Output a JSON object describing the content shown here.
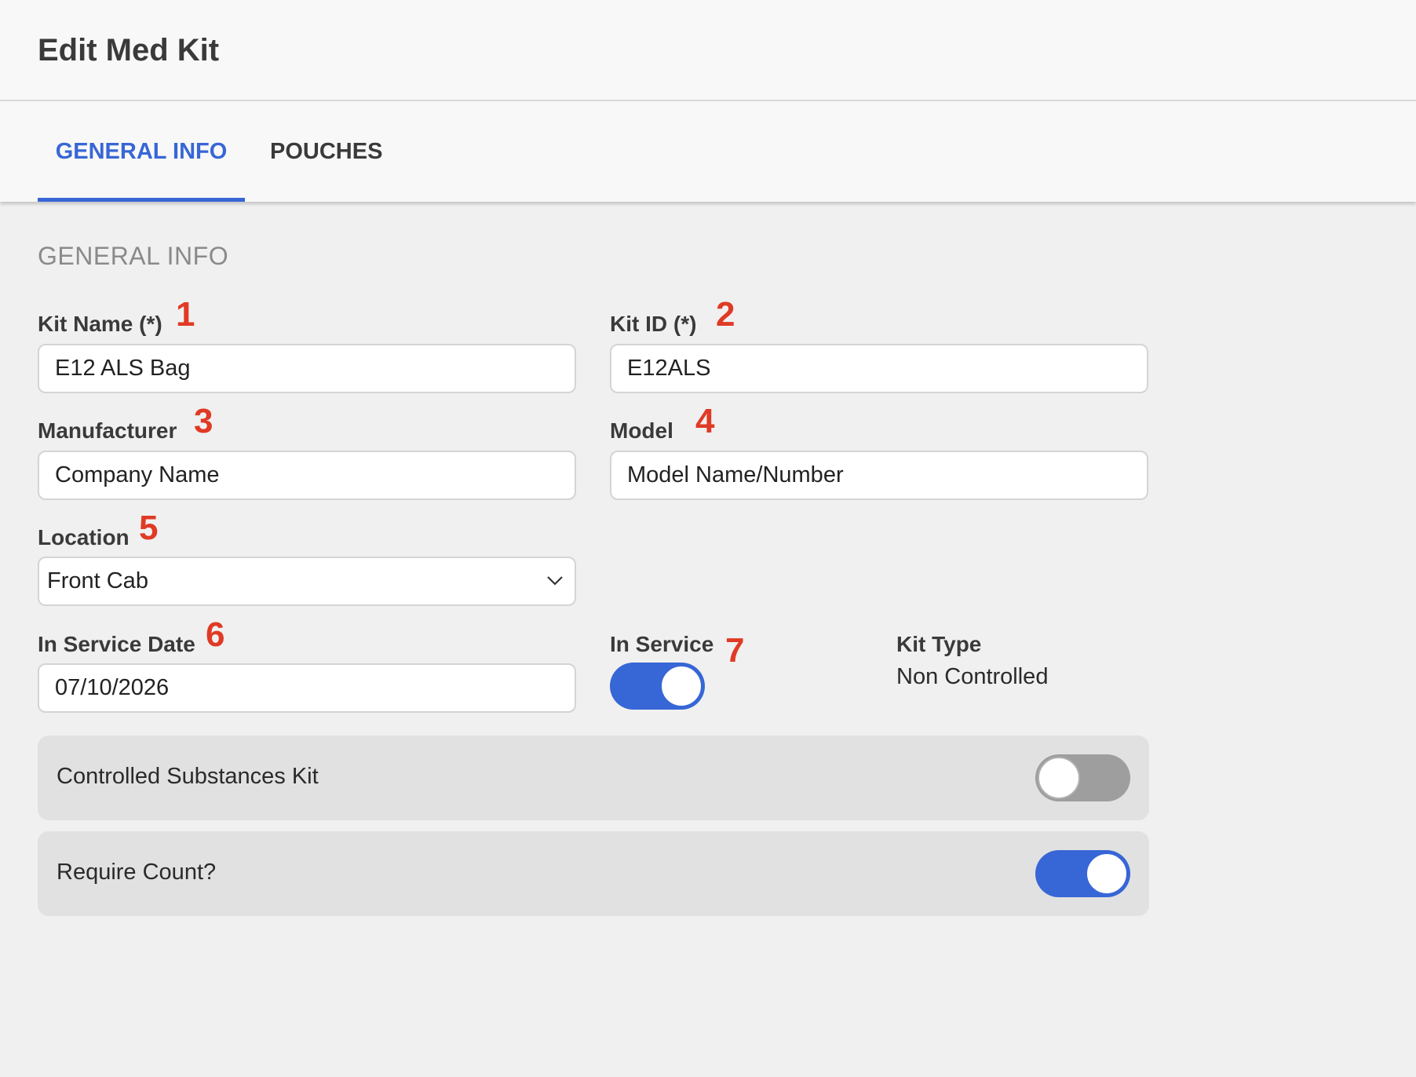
{
  "header": {
    "title": "Edit Med Kit"
  },
  "tabs": [
    {
      "label": "GENERAL INFO",
      "active": true
    },
    {
      "label": "POUCHES",
      "active": false
    }
  ],
  "section_title": "GENERAL INFO",
  "fields": {
    "kit_name": {
      "label": "Kit Name (*)",
      "value": "E12 ALS Bag",
      "marker": "1"
    },
    "kit_id": {
      "label": "Kit ID (*)",
      "value": "E12ALS",
      "marker": "2"
    },
    "manufacturer": {
      "label": "Manufacturer",
      "value": "Company Name",
      "marker": "3"
    },
    "model": {
      "label": "Model",
      "value": "Model Name/Number",
      "marker": "4"
    },
    "location": {
      "label": "Location",
      "value": "Front Cab",
      "marker": "5"
    },
    "in_service_date": {
      "label": "In Service Date",
      "value": "07/10/2026",
      "marker": "6"
    },
    "in_service": {
      "label": "In Service",
      "on": true,
      "marker": "7"
    },
    "kit_type": {
      "label": "Kit Type",
      "value": "Non Controlled"
    }
  },
  "panels": {
    "controlled_substances": {
      "label": "Controlled Substances Kit",
      "on": false
    },
    "require_count": {
      "label": "Require Count?",
      "on": true
    }
  },
  "colors": {
    "accent": "#3766d6",
    "marker": "#e03a25",
    "toggle_off": "#9e9e9e"
  },
  "icons": {
    "location_dropdown": "chevron-down-icon"
  }
}
